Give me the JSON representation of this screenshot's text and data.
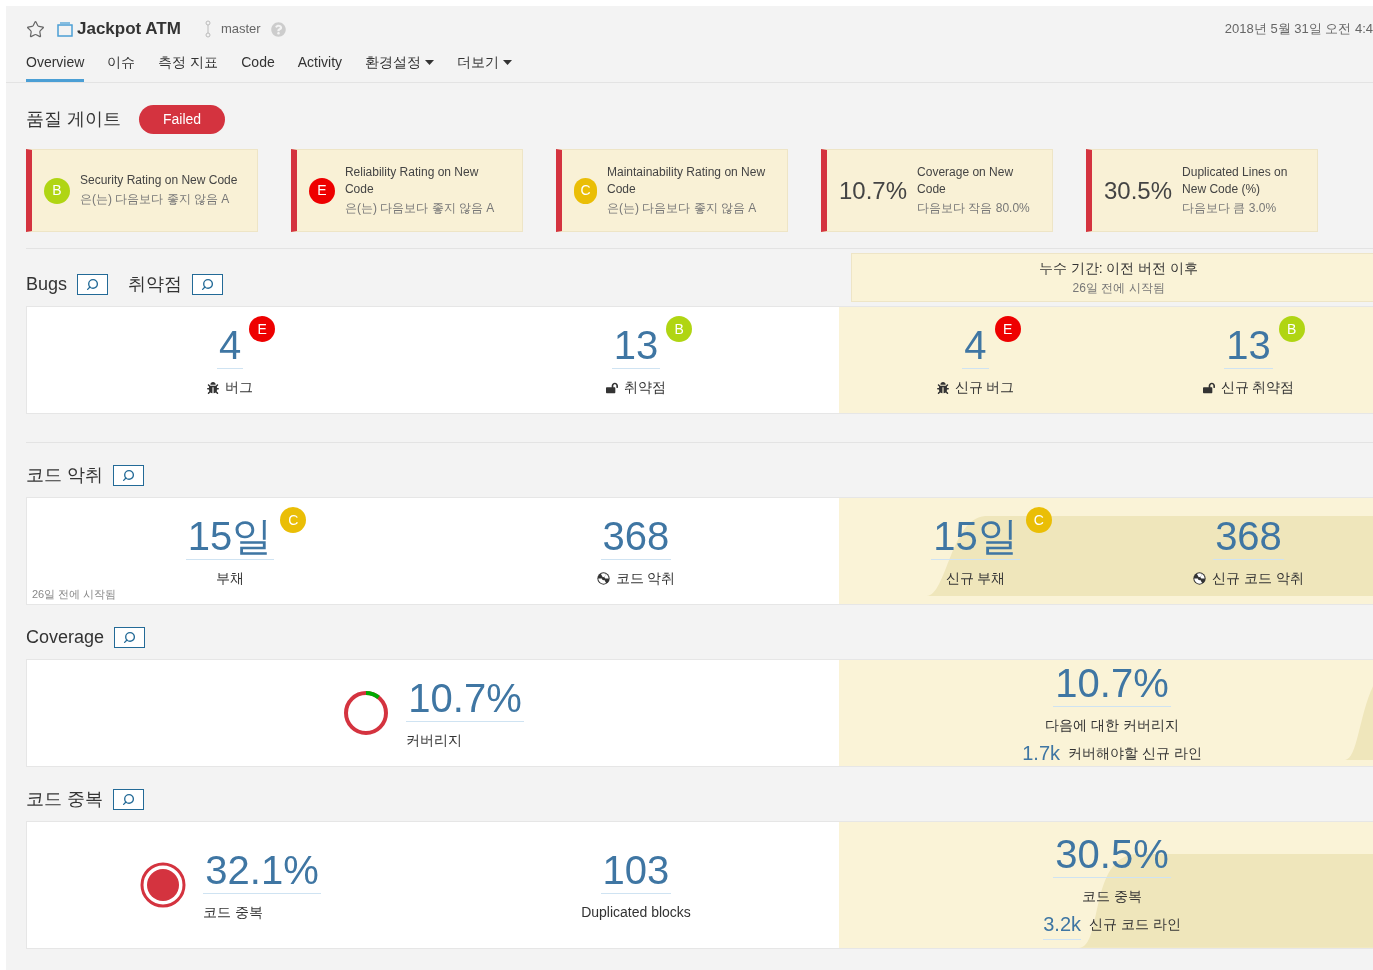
{
  "project": {
    "name": "Jackpot ATM",
    "branch": "master",
    "date": "2018년 5월 31일 오전 4:4"
  },
  "tabs": [
    {
      "label": "Overview",
      "selected": true,
      "kind": "link"
    },
    {
      "label": "이슈",
      "selected": false,
      "kind": "link"
    },
    {
      "label": "측정 지표",
      "selected": false,
      "kind": "link"
    },
    {
      "label": "Code",
      "selected": false,
      "kind": "link"
    },
    {
      "label": "Activity",
      "selected": false,
      "kind": "link"
    },
    {
      "label": "환경설정",
      "selected": false,
      "kind": "menu"
    },
    {
      "label": "더보기",
      "selected": false,
      "kind": "menu"
    }
  ],
  "quality_gate": {
    "title": "품질 게이트",
    "status": "Failed",
    "conditions": [
      {
        "kind": "rating",
        "rating": "B",
        "color": "#b0d513",
        "label": "Security Rating on New Code",
        "threshold": "은(는) 다음보다 좋지 않음 A"
      },
      {
        "kind": "rating",
        "rating": "E",
        "color": "#ee0000",
        "label": "Reliability Rating on New Code",
        "threshold": "은(는) 다음보다 좋지 않음 A"
      },
      {
        "kind": "rating",
        "rating": "C",
        "color": "#eabe06",
        "label": "Maintainability Rating on New Code",
        "threshold": "은(는) 다음보다 좋지 않음 A"
      },
      {
        "kind": "value",
        "value": "10.7%",
        "label": "Coverage on New Code",
        "threshold": "다음보다 작음 80.0%"
      },
      {
        "kind": "value",
        "value": "30.5%",
        "label": "Duplicated Lines on New Code (%)",
        "threshold": "다음보다 큼 3.0%"
      }
    ]
  },
  "leak_period": {
    "title": "누수 기간: 이전 버전 이후",
    "subtitle": "26일 전에 시작됨"
  },
  "sections": [
    {
      "titles": [
        "Bugs",
        "취약점"
      ],
      "overall": [
        {
          "kind": "bug",
          "value": "4",
          "rating": "E",
          "color": "#ee0000",
          "label": "버그"
        },
        {
          "kind": "vulnerability",
          "value": "13",
          "rating": "B",
          "color": "#b0d513",
          "label": "취약점"
        }
      ],
      "new": [
        {
          "kind": "bug",
          "value": "4",
          "rating": "E",
          "color": "#ee0000",
          "label": "신규 버그"
        },
        {
          "kind": "vulnerability",
          "value": "13",
          "rating": "B",
          "color": "#b0d513",
          "label": "신규 취약점"
        }
      ]
    },
    {
      "titles": [
        "코드 악취"
      ],
      "note": "26일 전에 시작됨",
      "overall": [
        {
          "kind": "debt",
          "value": "15일",
          "rating": "C",
          "color": "#eabe06",
          "label": "부채"
        },
        {
          "kind": "code_smell",
          "value": "368",
          "label": "코드 악취"
        }
      ],
      "new": [
        {
          "kind": "debt",
          "value": "15일",
          "rating": "C",
          "color": "#eabe06",
          "label": "신규 부채"
        },
        {
          "kind": "code_smell",
          "value": "368",
          "label": "신규 코드 악취"
        }
      ]
    },
    {
      "titles": [
        "Coverage"
      ],
      "overall": [
        {
          "kind": "coverage",
          "value": "10.7%",
          "label": "커버리지"
        }
      ],
      "new": [
        {
          "kind": "plain",
          "value": "10.7%",
          "label": "다음에 대한 커버리지",
          "secondary_value": "1.7k",
          "secondary_label": "커버해야할 신규 라인"
        }
      ]
    },
    {
      "titles": [
        "코드 중복"
      ],
      "overall": [
        {
          "kind": "duplication",
          "value": "32.1%",
          "label": "코드 중복"
        },
        {
          "kind": "plain",
          "value": "103",
          "label": "Duplicated blocks"
        }
      ],
      "new": [
        {
          "kind": "plain",
          "value": "30.5%",
          "label": "코드 중복",
          "secondary_value": "3.2k",
          "secondary_label": "신규 코드 라인"
        }
      ]
    }
  ]
}
